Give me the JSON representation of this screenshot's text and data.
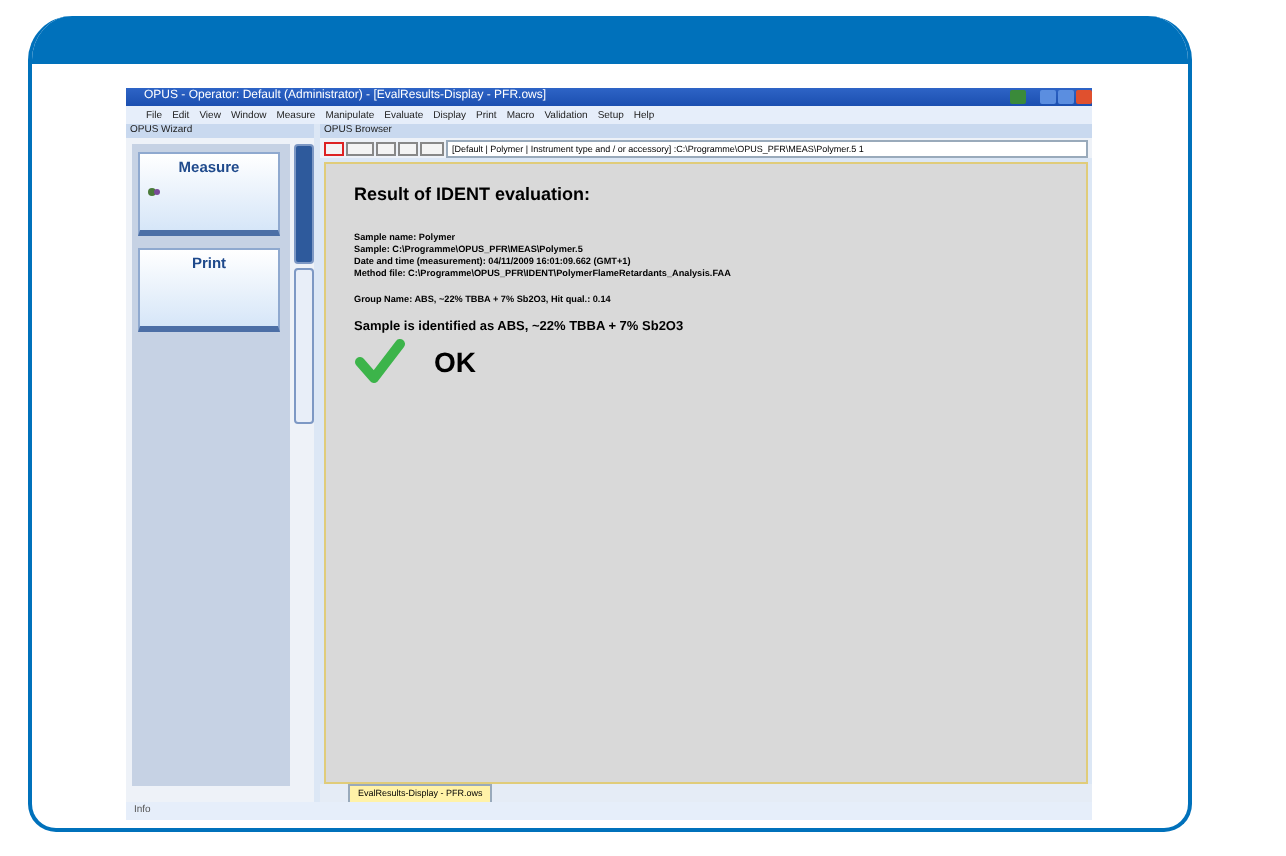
{
  "window": {
    "title": "OPUS - Operator: Default  (Administrator) - [EvalResults-Display - PFR.ows]"
  },
  "menu": [
    "File",
    "Edit",
    "View",
    "Window",
    "Measure",
    "Manipulate",
    "Evaluate",
    "Display",
    "Print",
    "Macro",
    "Validation",
    "Setup",
    "Help"
  ],
  "wizard": {
    "title": "OPUS Wizard",
    "buttons": [
      {
        "label": "Measure",
        "kind": "icon"
      },
      {
        "label": "Print",
        "kind": "plain"
      }
    ],
    "side_tabs": [
      {
        "selected": true
      },
      {
        "selected": false
      }
    ]
  },
  "browser": {
    "title": "OPUS Browser",
    "path": "[Default | Polymer | Instrument type and / or accessory] :C:\\Programme\\OPUS_PFR\\MEAS\\Polymer.5 1",
    "heading": "Result of IDENT evaluation:",
    "details": [
      "Sample name:  Polymer",
      "Sample:  C:\\Programme\\OPUS_PFR\\MEAS\\Polymer.5",
      "Date and time (measurement):  04/11/2009  16:01:09.662 (GMT+1)",
      "Method file:  C:\\Programme\\OPUS_PFR\\IDENT\\PolymerFlameRetardants_Analysis.FAA"
    ],
    "group": "Group Name:  ABS, ~22% TBBA + 7% Sb2O3,     Hit qual.:  0.14",
    "result": "Sample is identified as ABS, ~22% TBBA + 7% Sb2O3",
    "verdict": "OK",
    "tab": "EvalResults-Display - PFR.ows"
  },
  "status_bar": "Info"
}
